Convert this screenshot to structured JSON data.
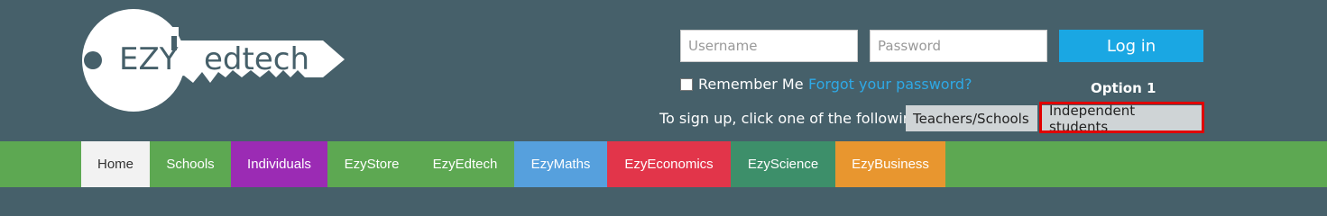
{
  "logo": {
    "part1": "EZY",
    "part2": "edtech"
  },
  "login": {
    "username_placeholder": "Username",
    "password_placeholder": "Password",
    "login_label": "Log in",
    "remember_label": "Remember Me",
    "forgot_label": "Forgot your password?",
    "option_label": "Option 1"
  },
  "signup": {
    "prompt": "To sign up, click one of the following:",
    "teachers_label": "Teachers/Schools",
    "students_label": "Independent students"
  },
  "nav": {
    "items": [
      {
        "label": "Home",
        "bg": "#f2f2f2",
        "fg": "#333333"
      },
      {
        "label": "Schools",
        "bg": "#5da852",
        "fg": "#ffffff"
      },
      {
        "label": "Individuals",
        "bg": "#9b2bb4",
        "fg": "#ffffff"
      },
      {
        "label": "EzyStore",
        "bg": "#5da852",
        "fg": "#ffffff"
      },
      {
        "label": "EzyEdtech",
        "bg": "#5da852",
        "fg": "#ffffff"
      },
      {
        "label": "EzyMaths",
        "bg": "#56a0dd",
        "fg": "#ffffff"
      },
      {
        "label": "EzyEconomics",
        "bg": "#e2354a",
        "fg": "#ffffff"
      },
      {
        "label": "EzyScience",
        "bg": "#3d8f6a",
        "fg": "#ffffff"
      },
      {
        "label": "EzyBusiness",
        "bg": "#e8962f",
        "fg": "#ffffff"
      }
    ]
  },
  "colors": {
    "header_bg": "#46606a",
    "nav_bg": "#5da852",
    "login_button": "#1aa7e3",
    "link": "#2ea9e6",
    "highlight": "#e00000"
  }
}
